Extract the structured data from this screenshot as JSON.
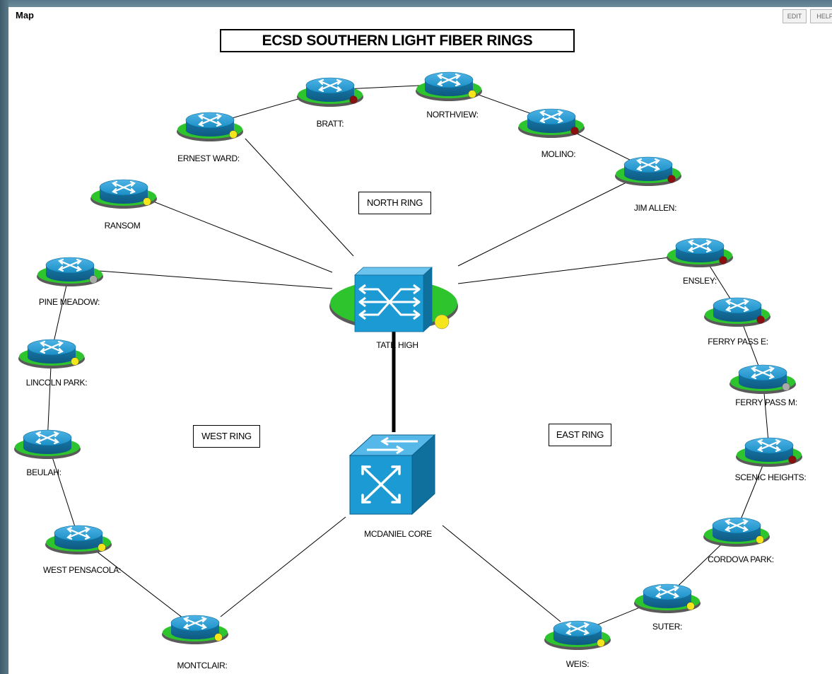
{
  "header": {
    "label": "Map",
    "edit_button": "EDIT",
    "help_button": "HELP"
  },
  "title": "ECSD SOUTHERN LIGHT FIBER RINGS",
  "rings": {
    "north": "NORTH RING",
    "west": "WEST RING",
    "east": "EAST RING"
  },
  "hubs": {
    "tate_high": "TATE HIGH",
    "mcdaniel_core": "MCDANIEL CORE"
  },
  "nodes": [
    {
      "id": "ernest-ward",
      "label": "ERNEST WARD:",
      "status": "yellow"
    },
    {
      "id": "bratt",
      "label": "BRATT:",
      "status": "red"
    },
    {
      "id": "northview",
      "label": "NORTHVIEW:",
      "status": "yellow"
    },
    {
      "id": "molino",
      "label": "MOLINO:",
      "status": "red"
    },
    {
      "id": "jim-allen",
      "label": "JIM ALLEN:",
      "status": "red"
    },
    {
      "id": "ransom",
      "label": "RANSOM",
      "status": "yellow"
    },
    {
      "id": "pine-meadow",
      "label": "PINE MEADOW:",
      "status": "gray"
    },
    {
      "id": "lincoln-park",
      "label": "LINCOLN PARK:",
      "status": "yellow"
    },
    {
      "id": "beulah",
      "label": "BEULAH:",
      "status": "none"
    },
    {
      "id": "west-pensacola",
      "label": "WEST PENSACOLA:",
      "status": "yellow"
    },
    {
      "id": "montclair",
      "label": "MONTCLAIR:",
      "status": "yellow"
    },
    {
      "id": "ensley",
      "label": "ENSLEY:",
      "status": "red"
    },
    {
      "id": "ferry-pass-e",
      "label": "FERRY PASS E:",
      "status": "red"
    },
    {
      "id": "ferry-pass-m",
      "label": "FERRY PASS M:",
      "status": "gray"
    },
    {
      "id": "scenic-heights",
      "label": "SCENIC HEIGHTS:",
      "status": "red"
    },
    {
      "id": "cordova-park",
      "label": "CORDOVA PARK:",
      "status": "yellow"
    },
    {
      "id": "suter",
      "label": "SUTER:",
      "status": "yellow"
    },
    {
      "id": "weis",
      "label": "WEIS:",
      "status": "yellow"
    }
  ],
  "links": [
    [
      "ernest-ward",
      "bratt"
    ],
    [
      "bratt",
      "northview"
    ],
    [
      "northview",
      "molino"
    ],
    [
      "molino",
      "jim-allen"
    ],
    [
      "ernest-ward",
      "tate-high"
    ],
    [
      "ransom",
      "tate-high"
    ],
    [
      "pine-meadow",
      "tate-high"
    ],
    [
      "jim-allen",
      "tate-high"
    ],
    [
      "ensley",
      "tate-high"
    ],
    [
      "pine-meadow",
      "lincoln-park"
    ],
    [
      "lincoln-park",
      "beulah"
    ],
    [
      "beulah",
      "west-pensacola"
    ],
    [
      "west-pensacola",
      "montclair"
    ],
    [
      "montclair",
      "mcdaniel-core"
    ],
    [
      "ensley",
      "ferry-pass-e"
    ],
    [
      "ferry-pass-e",
      "ferry-pass-m"
    ],
    [
      "ferry-pass-m",
      "scenic-heights"
    ],
    [
      "scenic-heights",
      "cordova-park"
    ],
    [
      "cordova-park",
      "suter"
    ],
    [
      "suter",
      "weis"
    ],
    [
      "weis",
      "mcdaniel-core"
    ]
  ],
  "core_link": [
    "tate-high",
    "mcdaniel-core"
  ],
  "colors": {
    "router_blue": "#1a8fc6",
    "platform_green": "#2ec42e",
    "status_yellow": "#f5e51c",
    "status_red": "#8a1010",
    "status_gray": "#a9a9a9",
    "line": "#000000"
  }
}
